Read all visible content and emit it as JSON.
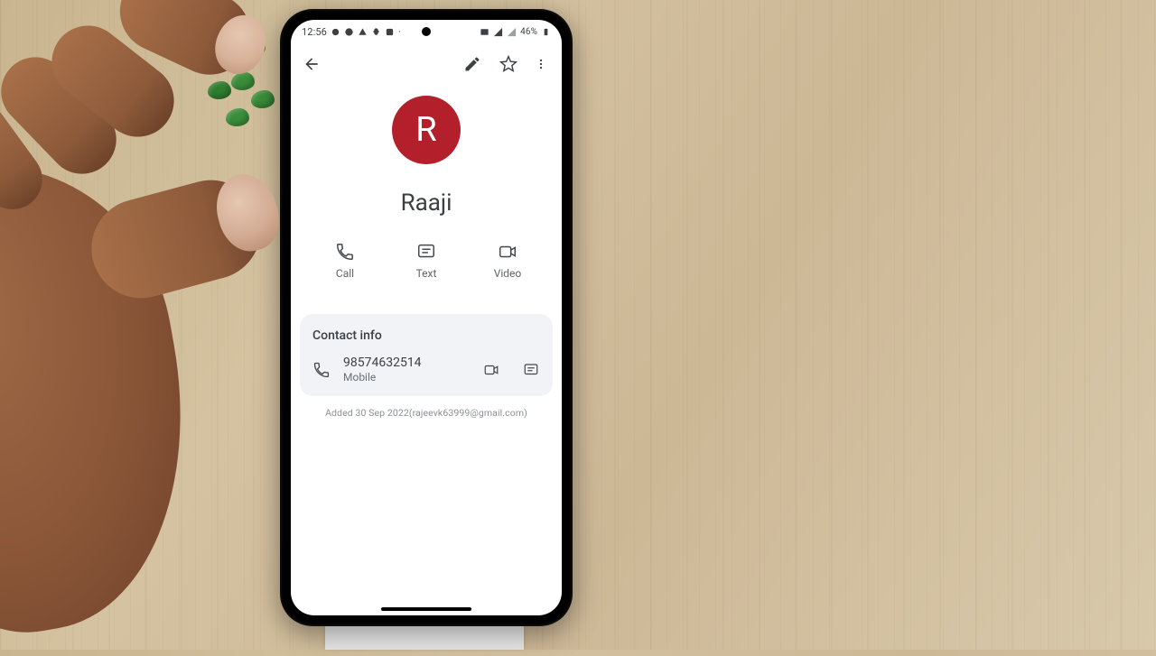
{
  "statusbar": {
    "time": "12:56",
    "battery": "46%"
  },
  "contact": {
    "initial": "R",
    "name": "Raaji",
    "avatar_color": "#b3202c"
  },
  "actions": {
    "call": "Call",
    "text": "Text",
    "video": "Video"
  },
  "card": {
    "title": "Contact info",
    "phone": "98574632514",
    "phone_label": "Mobile"
  },
  "added_note": "Added 30 Sep 2022(rajeevk63999@gmail.com)"
}
